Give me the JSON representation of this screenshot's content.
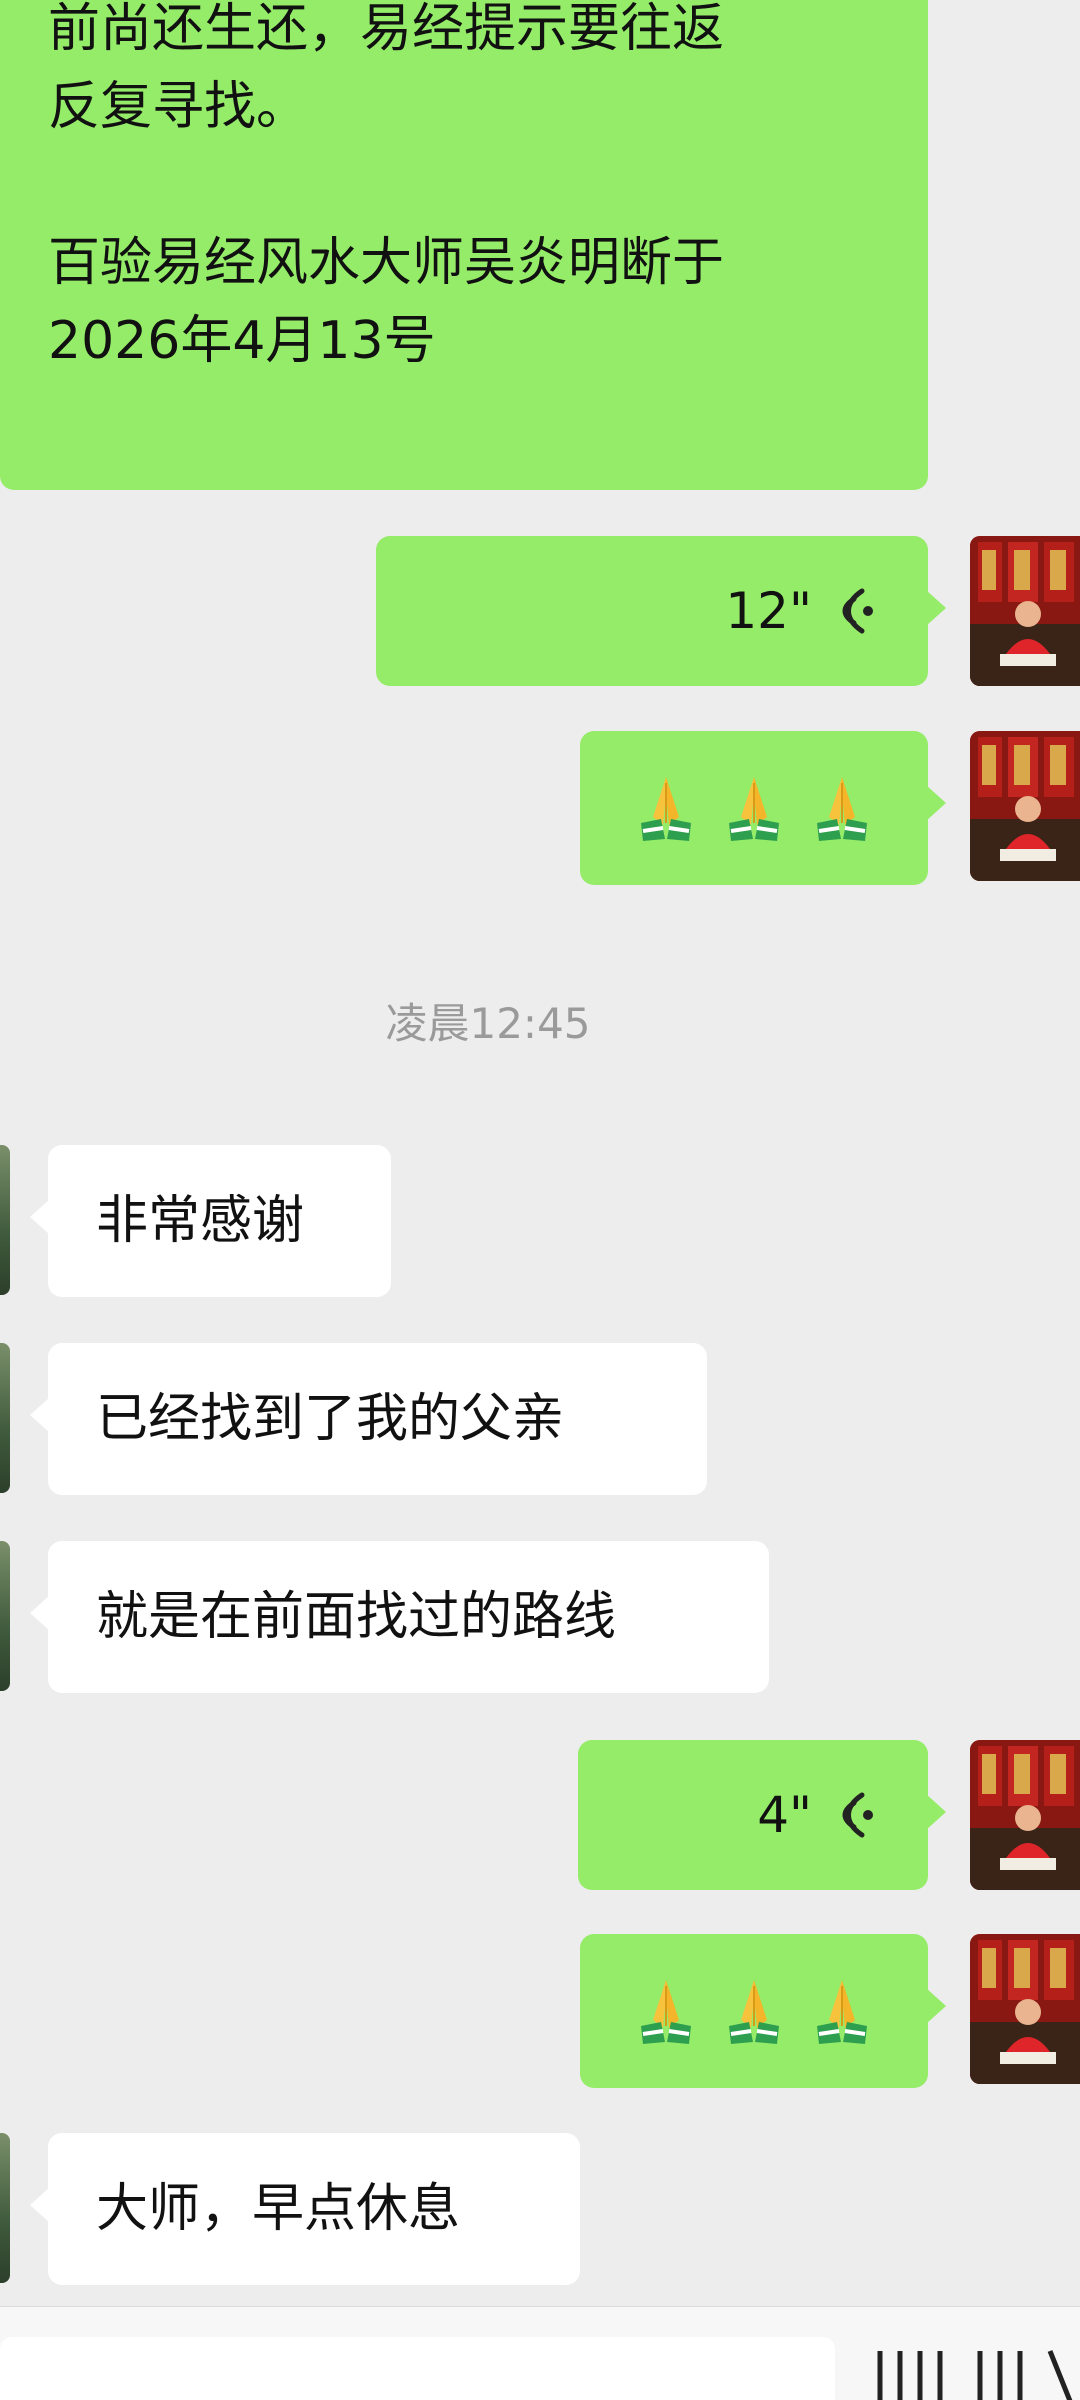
{
  "messages": {
    "m1": {
      "text": "前尚还生还，易经提示要往返\n反复寻找。\n\n百验易经风水大师吴炎明断于\n2026年4月13号"
    },
    "m2": {
      "duration": "12\""
    },
    "m3": {
      "emoji": "🙏🙏🙏"
    },
    "time_divider": "凌晨12:45",
    "m4": {
      "text": "非常感谢"
    },
    "m5": {
      "text": "已经找到了我的父亲"
    },
    "m6": {
      "text": "就是在前面找过的路线"
    },
    "m7": {
      "duration": "4\""
    },
    "m8": {
      "emoji": "🙏🙏🙏"
    },
    "m9": {
      "text": "大师，早点休息"
    }
  },
  "icons": {
    "voice": "voice-wave-icon",
    "praying": "folded-hands-icon",
    "avatar": "user-avatar"
  },
  "colors": {
    "outgoing_bubble": "#95ec69",
    "incoming_bubble": "#ffffff",
    "background": "#ededed",
    "timestamp": "#9a9a9a"
  }
}
